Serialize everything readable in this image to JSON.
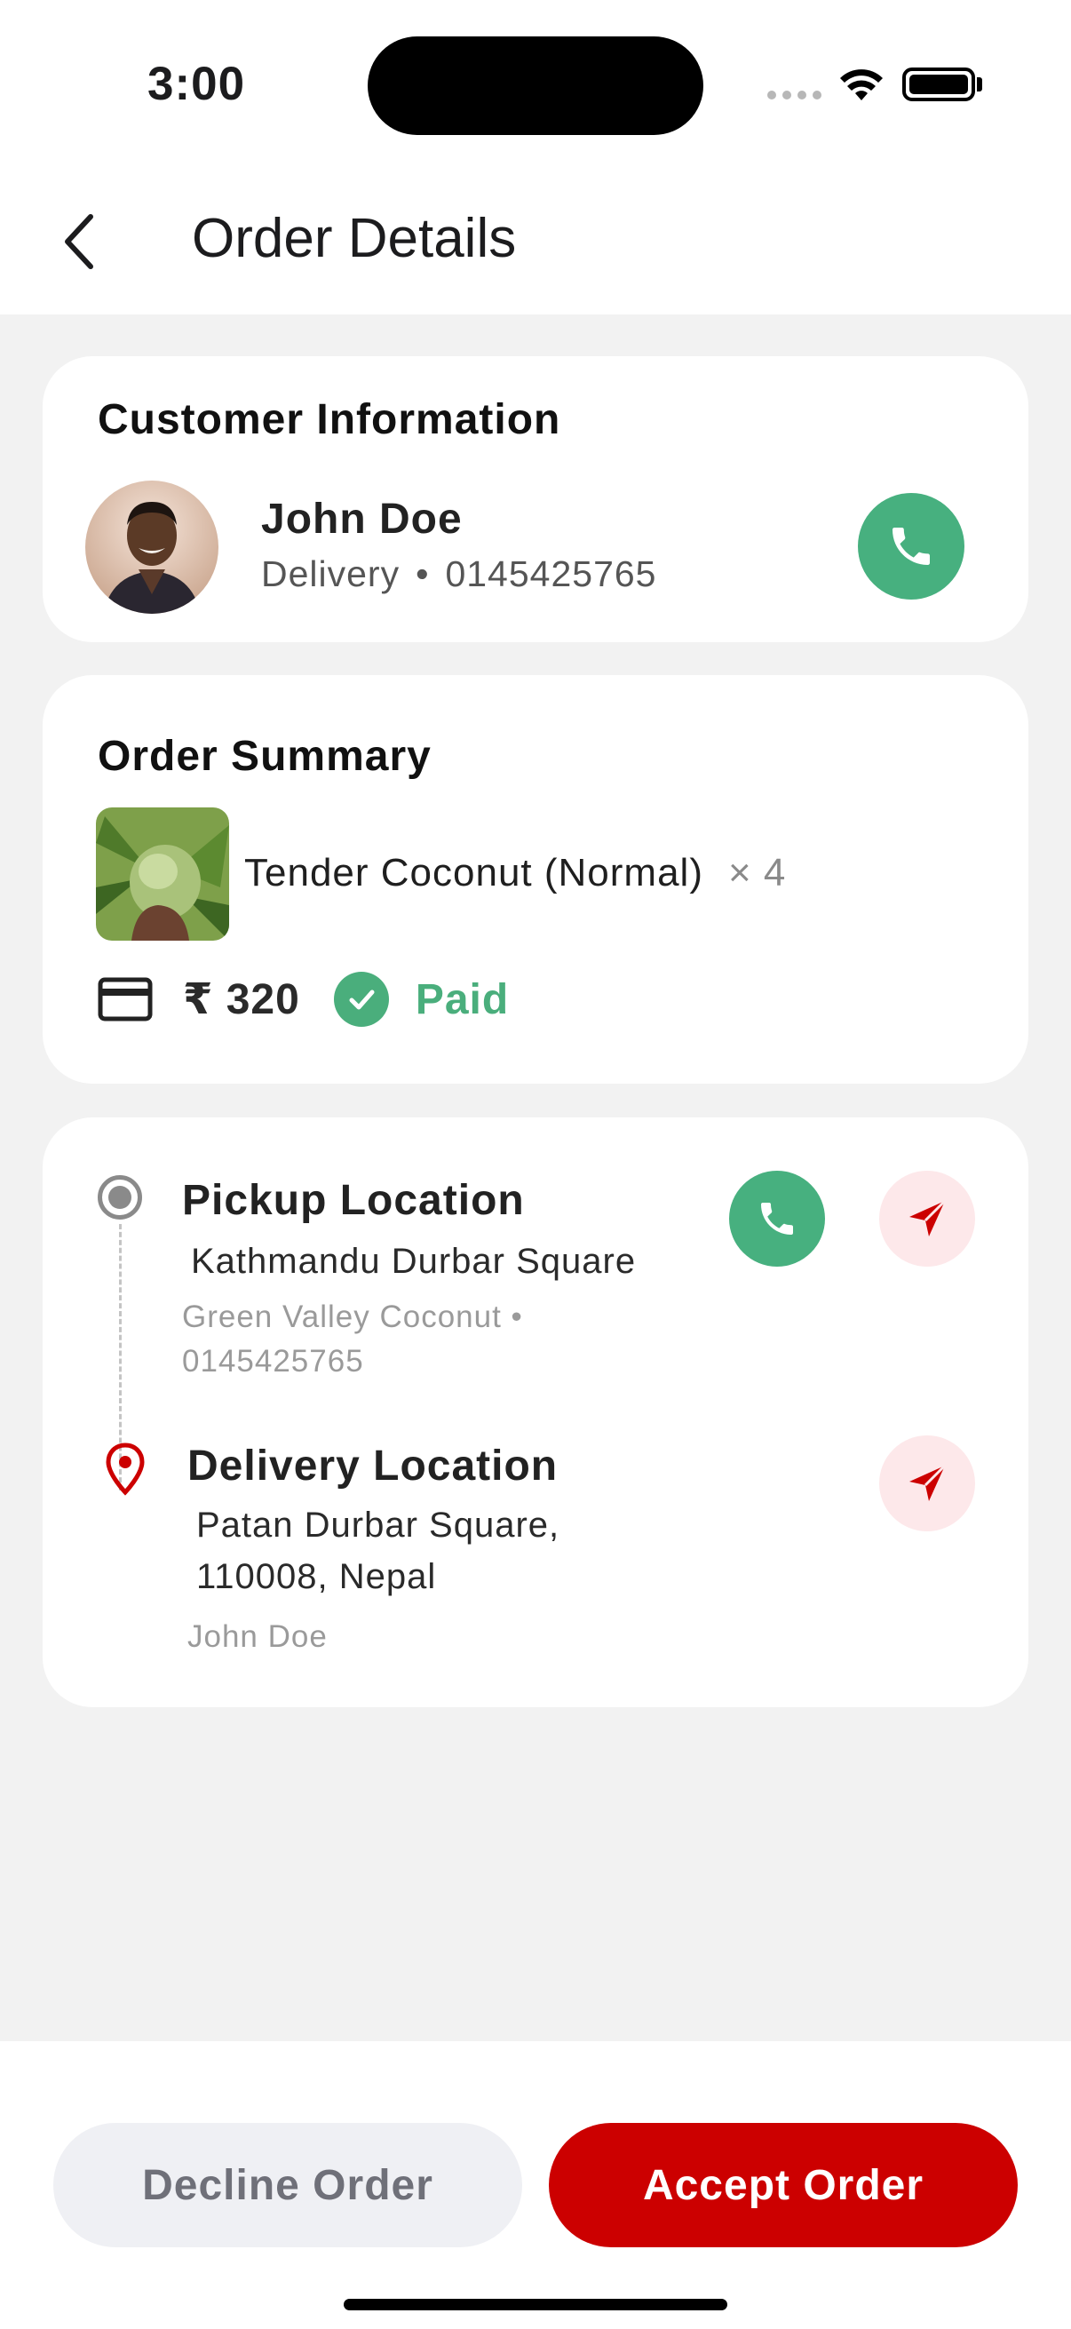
{
  "status_bar": {
    "time": "3:00"
  },
  "header": {
    "title": "Order Details"
  },
  "customer": {
    "section_title": "Customer Information",
    "name": "John Doe",
    "type": "Delivery",
    "separator": "•",
    "phone": "0145425765"
  },
  "order": {
    "section_title": "Order Summary",
    "item_name": "Tender Coconut (Normal)",
    "item_qty": "× 4",
    "price": "₹ 320",
    "payment_status": "Paid"
  },
  "pickup": {
    "title": "Pickup Location",
    "address": "Kathmandu Durbar Square",
    "meta_line1": "Green Valley Coconut •",
    "meta_line2": "0145425765"
  },
  "delivery": {
    "title": "Delivery Location",
    "address_line1": "Patan Durbar Square,",
    "address_line2": "110008, Nepal",
    "recipient": "John Doe"
  },
  "actions": {
    "decline_label": "Decline Order",
    "accept_label": "Accept Order"
  },
  "colors": {
    "accent_red": "#cc0000",
    "call_green": "#47b07f",
    "paid_green": "#4aae7c"
  }
}
